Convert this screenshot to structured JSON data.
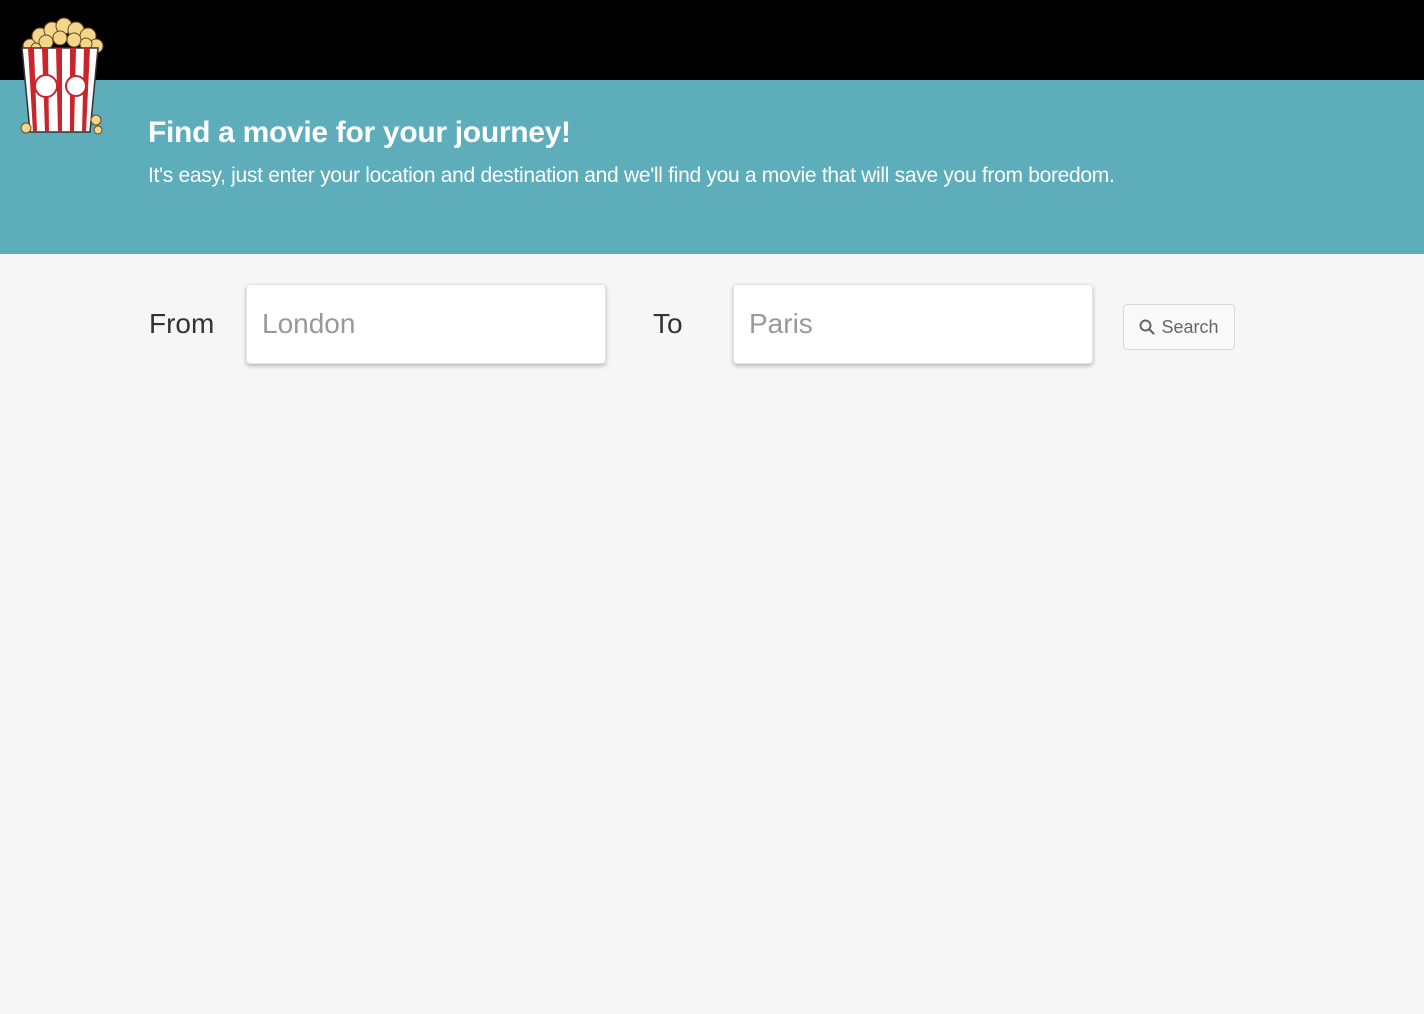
{
  "header": {
    "logo_icon": "popcorn-box-icon"
  },
  "hero": {
    "title": "Find a movie for your journey!",
    "subtitle": "It's easy, just enter your location and destination and we'll find you a movie that will save you from boredom.",
    "background_color": "#5eadbb"
  },
  "search_form": {
    "from_label": "From",
    "from_placeholder": "London",
    "from_value": "",
    "to_label": "To",
    "to_placeholder": "Paris",
    "to_value": "",
    "search_button_label": "Search",
    "search_button_icon": "search-icon"
  }
}
